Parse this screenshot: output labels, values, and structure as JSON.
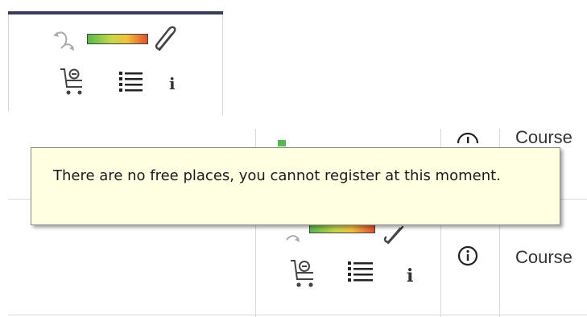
{
  "tooltip": {
    "text": "There are no free places, you cannot register at this moment."
  },
  "rows": [
    {
      "course_label": "Course",
      "info_glyph": "info-icon"
    },
    {
      "course_label": "Course",
      "info_glyph": "info-icon"
    }
  ],
  "icons": {
    "small_info": "i"
  },
  "colors": {
    "tooltip_bg": "#ffffe1",
    "bar_green": "#58b84e",
    "bar_yellow": "#f0c23c",
    "bar_red": "#e2502d",
    "header_line": "#3b3b5c"
  }
}
